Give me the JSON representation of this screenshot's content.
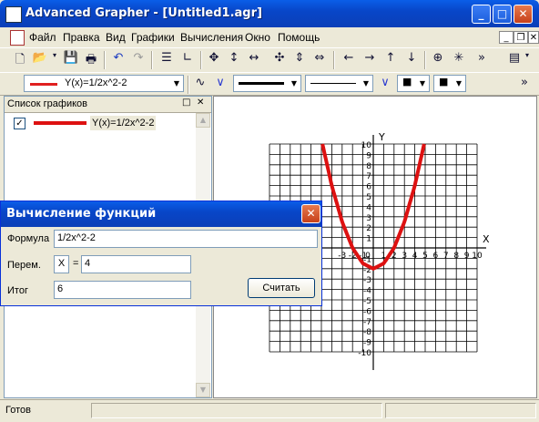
{
  "window": {
    "title": "Advanced Grapher - [Untitled1.agr]"
  },
  "menu": [
    "Файл",
    "Правка",
    "Вид",
    "Графики",
    "Вычисления",
    "Окно",
    "Помощь"
  ],
  "toolbar": {
    "function_combo": "Y(x)=1/2x^2-2",
    "line_color": "#e02020",
    "overflow": "»"
  },
  "graphs_panel": {
    "title": "Список графиков",
    "items": [
      {
        "checked": true,
        "label": "Y(x)=1/2x^2-2",
        "color": "#dd1111"
      }
    ]
  },
  "graph": {
    "x_axis_label": "X",
    "y_axis_label": "Y",
    "origin_label": "0",
    "x_ticks": [
      "-3",
      "-2",
      "-1",
      "0",
      "1",
      "2",
      "3",
      "4",
      "5",
      "6",
      "7",
      "8",
      "9",
      "10"
    ],
    "y_ticks": [
      "10",
      "9",
      "8",
      "7",
      "6",
      "5",
      "4",
      "3",
      "2",
      "1",
      "-1",
      "-2",
      "-3",
      "-4",
      "-5",
      "-6",
      "-7",
      "-8",
      "-9",
      "-10"
    ],
    "curve_color": "#dd1111"
  },
  "chart_data": {
    "type": "line",
    "title": "",
    "series": [
      {
        "name": "Y(x)=1/2x^2-2",
        "x": [
          -4.9,
          -4,
          -3,
          -2,
          -1,
          0,
          1,
          2,
          3,
          4,
          4.9
        ],
        "y": [
          10,
          6,
          2.5,
          0,
          -1.5,
          -2,
          -1.5,
          0,
          2.5,
          6,
          10
        ]
      }
    ],
    "xlim": [
      -10,
      10
    ],
    "ylim": [
      -10,
      10
    ],
    "grid": true
  },
  "dialog": {
    "title": "Вычисление функций",
    "formula_label": "Формула",
    "formula_value": "1/2x^2-2",
    "var_label": "Перем.",
    "var_name": "X",
    "equals": "=",
    "var_value": "4",
    "result_label": "Итог",
    "result_value": "6",
    "calc_button": "Считать"
  },
  "status": {
    "text": "Готов"
  }
}
